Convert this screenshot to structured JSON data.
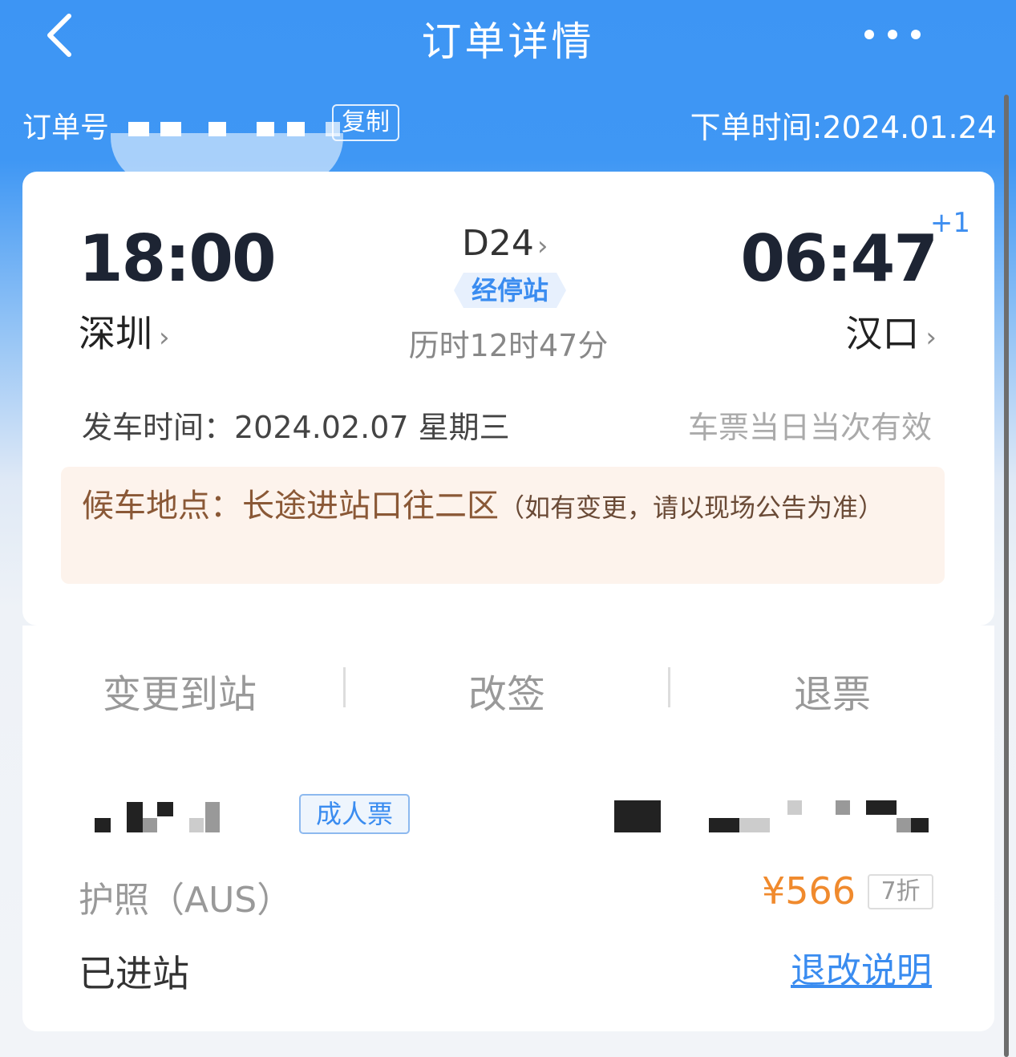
{
  "header": {
    "title": "订单详情",
    "back_icon": "chevron-left-icon",
    "more_icon": "more-horizontal-icon"
  },
  "order": {
    "number_label": "订单号",
    "copy_label": "复制",
    "placed_time": "下单时间:2024.01.24"
  },
  "trip": {
    "depart_time": "18:00",
    "depart_station": "深圳",
    "arrive_time": "06:47",
    "arrive_day_offset": "+1",
    "arrive_station": "汉口",
    "train_number": "D24",
    "stops_label": "经停站",
    "duration": "历时12时47分",
    "depart_date": "发车时间：2024.02.07 星期三",
    "validity": "车票当日当次有效",
    "waiting_area": "候车地点：长途进站口往二区",
    "waiting_note": "（如有变更，请以现场公告为准）"
  },
  "actions": {
    "change_destination": "变更到站",
    "reschedule": "改签",
    "refund": "退票"
  },
  "passenger": {
    "ticket_type": "成人票",
    "id_type": "护照（AUS）",
    "price": "¥566",
    "discount": "7折",
    "status": "已进站",
    "refund_policy_link": "退改说明"
  },
  "colors": {
    "header_blue": "#3d95f4",
    "accent_blue": "#3a8cf0",
    "price_orange": "#f08a2d",
    "waiting_bg": "#fdf3ec"
  }
}
